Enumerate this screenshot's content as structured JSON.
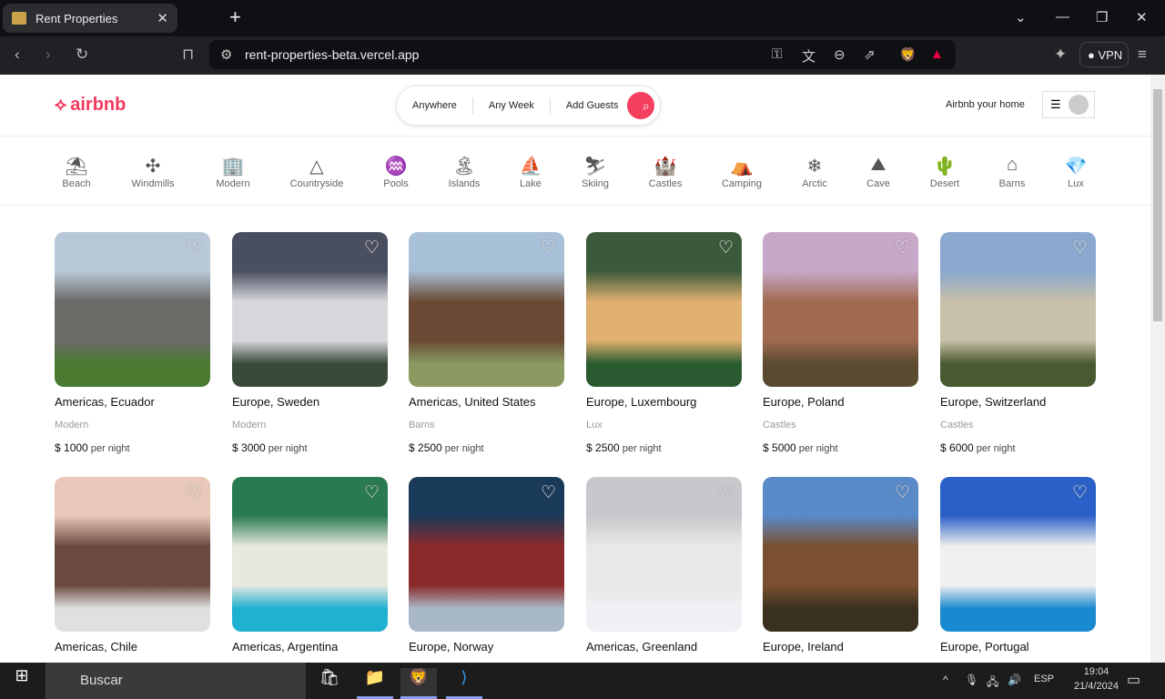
{
  "browser": {
    "tab_title": "Rent Properties",
    "url": "rent-properties-beta.vercel.app",
    "vpn_label": "VPN"
  },
  "header": {
    "logo": "airbnb",
    "search": {
      "where": "Anywhere",
      "when": "Any Week",
      "guests": "Add Guests"
    },
    "host_link": "Airbnb your home"
  },
  "categories": [
    {
      "label": "Beach",
      "icon": "beach-icon",
      "glyph": "⛱"
    },
    {
      "label": "Windmills",
      "icon": "windmill-icon",
      "glyph": "✣"
    },
    {
      "label": "Modern",
      "icon": "modern-icon",
      "glyph": "🏢"
    },
    {
      "label": "Countryside",
      "icon": "mountain-icon",
      "glyph": "△"
    },
    {
      "label": "Pools",
      "icon": "pool-icon",
      "glyph": "♒"
    },
    {
      "label": "Islands",
      "icon": "island-icon",
      "glyph": "🏝"
    },
    {
      "label": "Lake",
      "icon": "boat-icon",
      "glyph": "⛵"
    },
    {
      "label": "Skiing",
      "icon": "ski-icon",
      "glyph": "⛷"
    },
    {
      "label": "Castles",
      "icon": "castle-icon",
      "glyph": "🏰"
    },
    {
      "label": "Camping",
      "icon": "forest-icon",
      "glyph": "⛺"
    },
    {
      "label": "Arctic",
      "icon": "snowflake-icon",
      "glyph": "❄"
    },
    {
      "label": "Cave",
      "icon": "cave-icon",
      "glyph": "⛰"
    },
    {
      "label": "Desert",
      "icon": "cactus-icon",
      "glyph": "🌵"
    },
    {
      "label": "Barns",
      "icon": "barn-icon",
      "glyph": "⌂"
    },
    {
      "label": "Lux",
      "icon": "diamond-icon",
      "glyph": "💎"
    }
  ],
  "currency": "$",
  "per_night": "per night",
  "listings": [
    {
      "location": "Americas, Ecuador",
      "category": "Modern",
      "price": "1000",
      "colors": [
        "#b8c8d8",
        "#6a6a66",
        "#4a7a30"
      ]
    },
    {
      "location": "Europe, Sweden",
      "category": "Modern",
      "price": "3000",
      "colors": [
        "#4a4f60",
        "#d8d8dc",
        "#3a4a3a"
      ]
    },
    {
      "location": "Americas, United States",
      "category": "Barns",
      "price": "2500",
      "colors": [
        "#a8c0d8",
        "#6a4a34",
        "#8a9a60"
      ]
    },
    {
      "location": "Europe, Luxembourg",
      "category": "Lux",
      "price": "2500",
      "colors": [
        "#3a5a3a",
        "#e0b070",
        "#2a5a30"
      ]
    },
    {
      "location": "Europe, Poland",
      "category": "Castles",
      "price": "5000",
      "colors": [
        "#c8a8c8",
        "#a06a50",
        "#5a4a30"
      ]
    },
    {
      "location": "Europe, Switzerland",
      "category": "Castles",
      "price": "6000",
      "colors": [
        "#8aa8d0",
        "#c8c0a8",
        "#4a5a30"
      ]
    },
    {
      "location": "Americas, Chile",
      "category": "",
      "price": "",
      "colors": [
        "#e8c8b8",
        "#6a4a40",
        "#e0e0e0"
      ]
    },
    {
      "location": "Americas, Argentina",
      "category": "",
      "price": "",
      "colors": [
        "#2a7a50",
        "#e8e8e0",
        "#20b0d0"
      ]
    },
    {
      "location": "Europe, Norway",
      "category": "",
      "price": "",
      "colors": [
        "#1a3a5a",
        "#8a2a2a",
        "#a8b8c8"
      ]
    },
    {
      "location": "Americas, Greenland",
      "category": "",
      "price": "",
      "colors": [
        "#c8c8cc",
        "#e8e8e8",
        "#f0f0f4"
      ]
    },
    {
      "location": "Europe, Ireland",
      "category": "",
      "price": "",
      "colors": [
        "#5a8ac8",
        "#7a5030",
        "#3a3020"
      ]
    },
    {
      "location": "Europe, Portugal",
      "category": "",
      "price": "",
      "colors": [
        "#2a60c8",
        "#f0f0f0",
        "#1a8ad0"
      ]
    }
  ],
  "taskbar": {
    "search": "Buscar",
    "lang": "ESP",
    "time": "19:04",
    "date": "21/4/2024"
  }
}
